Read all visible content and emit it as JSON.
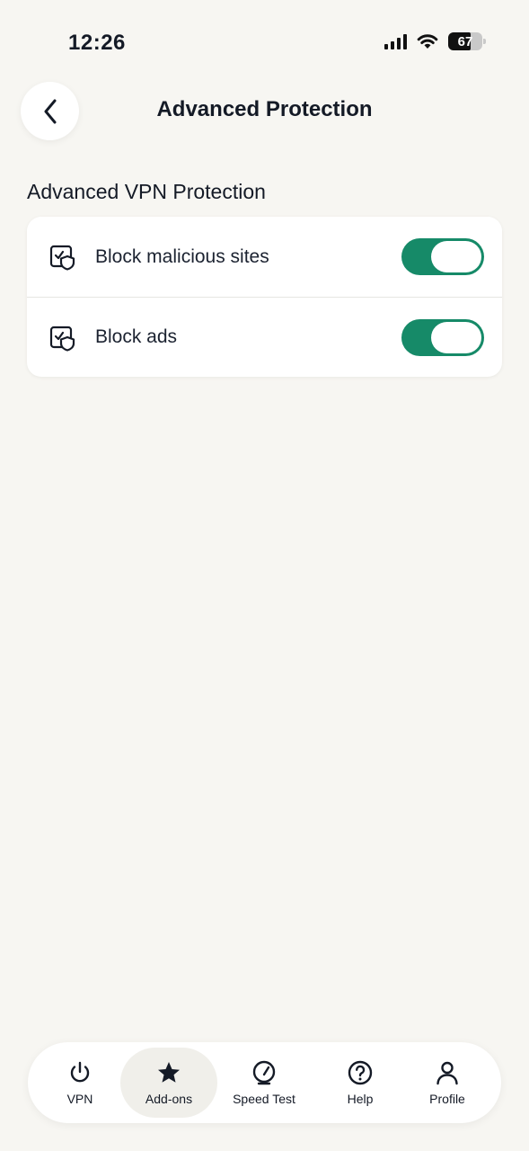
{
  "status_bar": {
    "time": "12:26",
    "battery_level": "67",
    "signal_icon": "cellular-signal-icon",
    "wifi_icon": "wifi-icon"
  },
  "header": {
    "back_icon": "chevron-left-icon",
    "title": "Advanced Protection"
  },
  "section": {
    "title": "Advanced VPN Protection",
    "items": [
      {
        "label": "Block malicious sites",
        "icon": "shield-window-icon",
        "enabled": true
      },
      {
        "label": "Block ads",
        "icon": "shield-window-icon",
        "enabled": true
      }
    ]
  },
  "tab_bar": {
    "tabs": [
      {
        "label": "VPN",
        "icon": "power-icon",
        "active": false
      },
      {
        "label": "Add-ons",
        "icon": "star-icon",
        "active": true
      },
      {
        "label": "Speed Test",
        "icon": "speedometer-icon",
        "active": false
      },
      {
        "label": "Help",
        "icon": "help-circle-icon",
        "active": false
      },
      {
        "label": "Profile",
        "icon": "user-icon",
        "active": false
      }
    ]
  },
  "colors": {
    "background": "#f7f6f2",
    "toggle_on": "#168a68",
    "text": "#141a26"
  }
}
